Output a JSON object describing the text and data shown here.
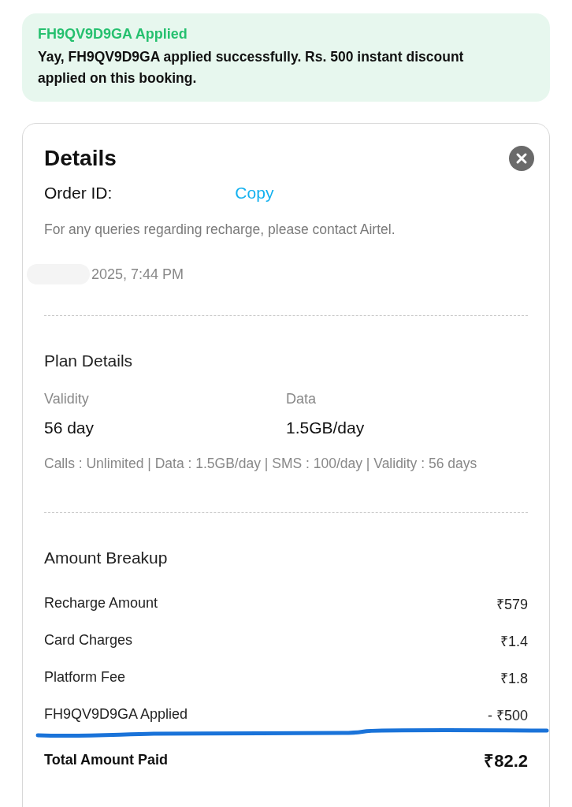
{
  "banner": {
    "title": "FH9QV9D9GA Applied",
    "message": "Yay, FH9QV9D9GA applied successfully. Rs. 500 instant discount applied on this booking."
  },
  "details": {
    "title": "Details",
    "order_id_label": "Order ID:",
    "copy_link": "Copy",
    "note": "For any queries regarding recharge, please contact Airtel.",
    "date": "2025, 7:44 PM"
  },
  "plan": {
    "title": "Plan Details",
    "facts": [
      {
        "label": "Validity",
        "value": "56 day"
      },
      {
        "label": "Data",
        "value": "1.5GB/day"
      }
    ],
    "summary": "Calls : Unlimited | Data : 1.5GB/day | SMS : 100/day | Validity : 56 days"
  },
  "breakup": {
    "title": "Amount Breakup",
    "rows": [
      {
        "label": "Recharge Amount",
        "amount": "₹579"
      },
      {
        "label": "Card Charges",
        "amount": "₹1.4"
      },
      {
        "label": "Platform Fee",
        "amount": "₹1.8"
      },
      {
        "label": "FH9QV9D9GA Applied",
        "amount": "- ₹500"
      }
    ],
    "total": {
      "label": "Total Amount Paid",
      "amount": "₹82.2"
    }
  }
}
